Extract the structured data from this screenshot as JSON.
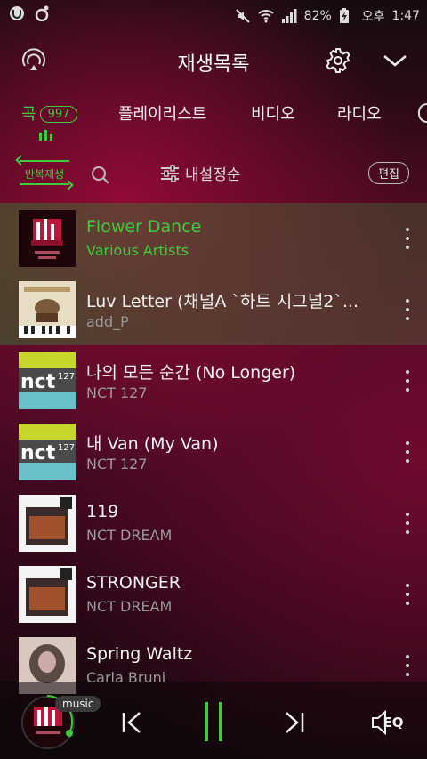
{
  "status": {
    "battery": "82%",
    "ampm": "오후",
    "time": "1:47"
  },
  "header": {
    "title": "재생목록"
  },
  "tabs": [
    {
      "label": "곡",
      "count": "997"
    },
    {
      "label": "플레이리스트"
    },
    {
      "label": "비디오"
    },
    {
      "label": "라디오"
    }
  ],
  "toolbar": {
    "repeat_label": "반복재생",
    "sort_label": "내설정순",
    "edit_label": "편집"
  },
  "songs": [
    {
      "title": "Flower Dance",
      "artist": "Various Artists"
    },
    {
      "title": "Luv Letter (채널A `하트 시그널2`...",
      "artist": "add_P"
    },
    {
      "title": "나의 모든 순간 (No Longer)",
      "artist": "NCT 127"
    },
    {
      "title": "내 Van (My Van)",
      "artist": "NCT 127"
    },
    {
      "title": "119",
      "artist": "NCT DREAM"
    },
    {
      "title": "STRONGER",
      "artist": "NCT DREAM"
    },
    {
      "title": "Spring Waltz",
      "artist": "Carla Bruni"
    }
  ],
  "player": {
    "tag": "music",
    "eq_label": "EQ"
  },
  "colors": {
    "accent": "#3ecc3e"
  }
}
